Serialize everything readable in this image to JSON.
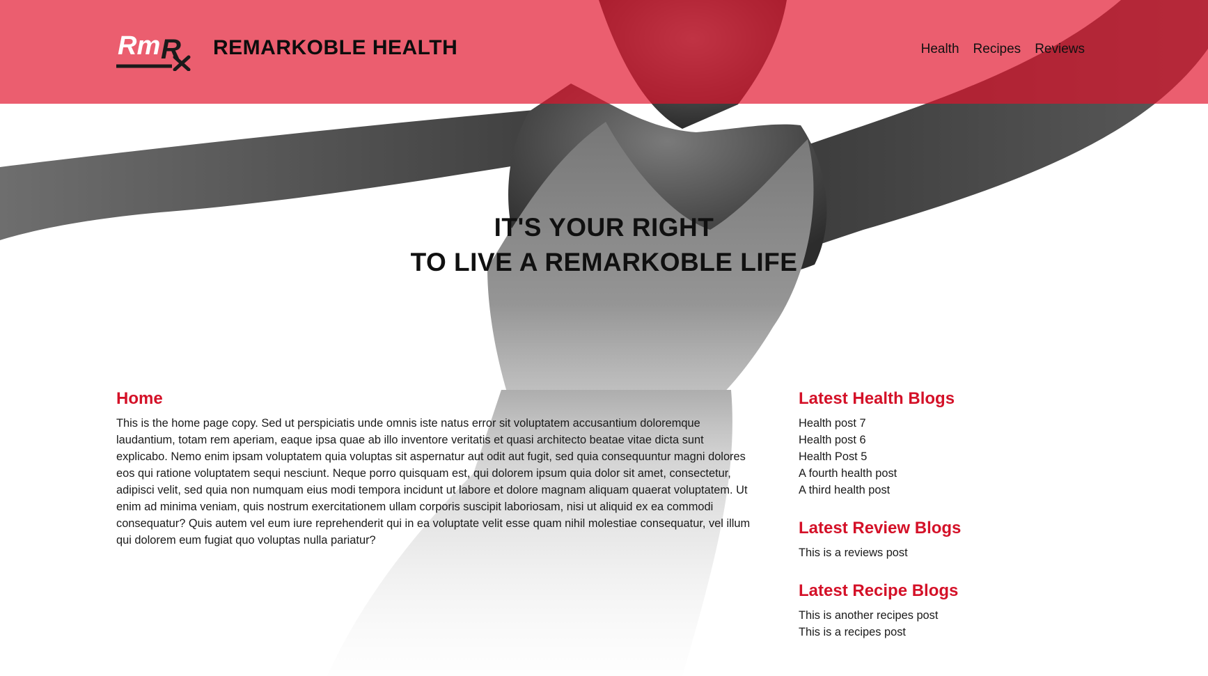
{
  "header": {
    "logo_text": "RmRx",
    "site_title": "REMARKOBLE HEALTH",
    "nav": [
      {
        "label": "Health"
      },
      {
        "label": "Recipes"
      },
      {
        "label": "Reviews"
      }
    ]
  },
  "hero": {
    "line1": "IT'S YOUR RIGHT",
    "line2": "TO LIVE A REMARKOBLE LIFE"
  },
  "main": {
    "heading": "Home",
    "copy": "This is the home page copy. Sed ut perspiciatis unde omnis iste natus error sit voluptatem accusantium doloremque laudantium, totam rem aperiam, eaque ipsa quae ab illo inventore veritatis et quasi architecto beatae vitae dicta sunt explicabo. Nemo enim ipsam voluptatem quia voluptas sit aspernatur aut odit aut fugit, sed quia consequuntur magni dolores eos qui ratione voluptatem sequi nesciunt. Neque porro quisquam est, qui dolorem ipsum quia dolor sit amet, consectetur, adipisci velit, sed quia non numquam eius modi tempora incidunt ut labore et dolore magnam aliquam quaerat voluptatem. Ut enim ad minima veniam, quis nostrum exercitationem ullam corporis suscipit laboriosam, nisi ut aliquid ex ea commodi consequatur? Quis autem vel eum iure reprehenderit qui in ea voluptate velit esse quam nihil molestiae consequatur, vel illum qui dolorem eum fugiat quo voluptas nulla pariatur?"
  },
  "sidebar": {
    "health": {
      "heading": "Latest Health Blogs",
      "posts": [
        "Health post 7",
        "Health post 6",
        "Health Post 5",
        "A fourth health post",
        "A third health post"
      ]
    },
    "reviews": {
      "heading": "Latest Review Blogs",
      "posts": [
        "This is a reviews post"
      ]
    },
    "recipes": {
      "heading": "Latest Recipe Blogs",
      "posts": [
        "This is another recipes post",
        "This is a recipes post"
      ]
    }
  },
  "colors": {
    "accent": "#d41128",
    "header_overlay": "#e2122b"
  }
}
